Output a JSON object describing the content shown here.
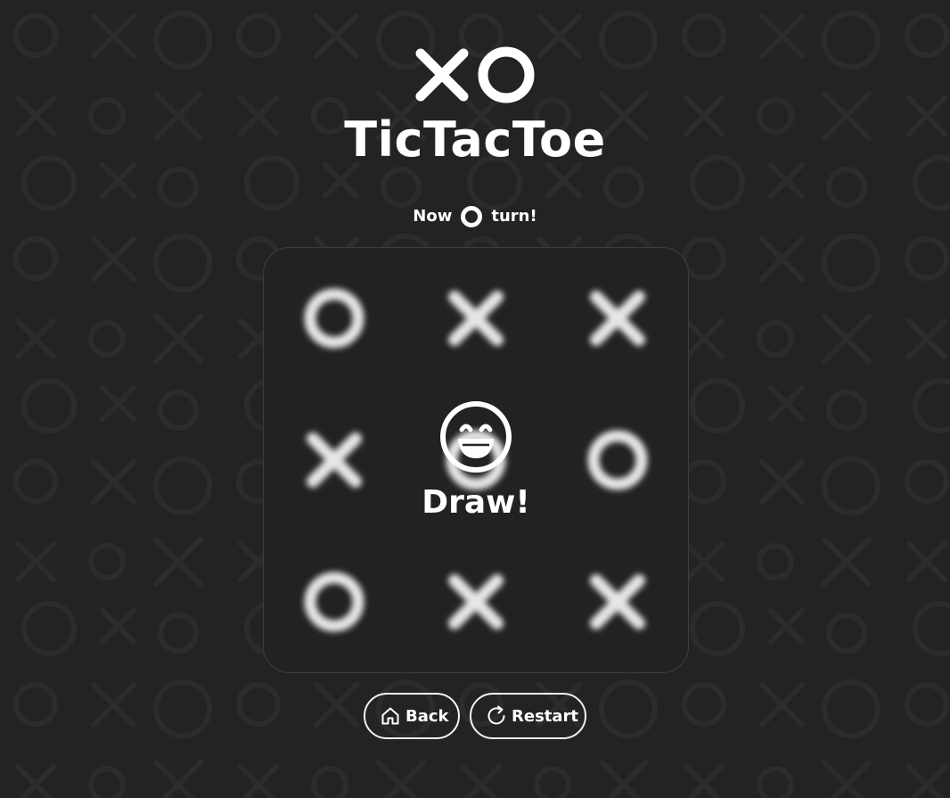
{
  "app": {
    "logo_letters": "XO",
    "title": "TicTacToe"
  },
  "status": {
    "prefix": "Now",
    "current_player": "O",
    "suffix": "turn!"
  },
  "board": {
    "cells": [
      "O",
      "X",
      "X",
      "X",
      "O",
      "O",
      "O",
      "X",
      "X"
    ],
    "blurred": true
  },
  "result": {
    "icon": "grinning-face-icon",
    "text": "Draw!"
  },
  "actions": {
    "back_label": "Back",
    "back_icon": "home-icon",
    "restart_label": "Restart",
    "restart_icon": "restart-icon"
  },
  "theme": {
    "background": "#232323",
    "foreground": "#ffffff",
    "board_border": "#3e3e3e"
  }
}
